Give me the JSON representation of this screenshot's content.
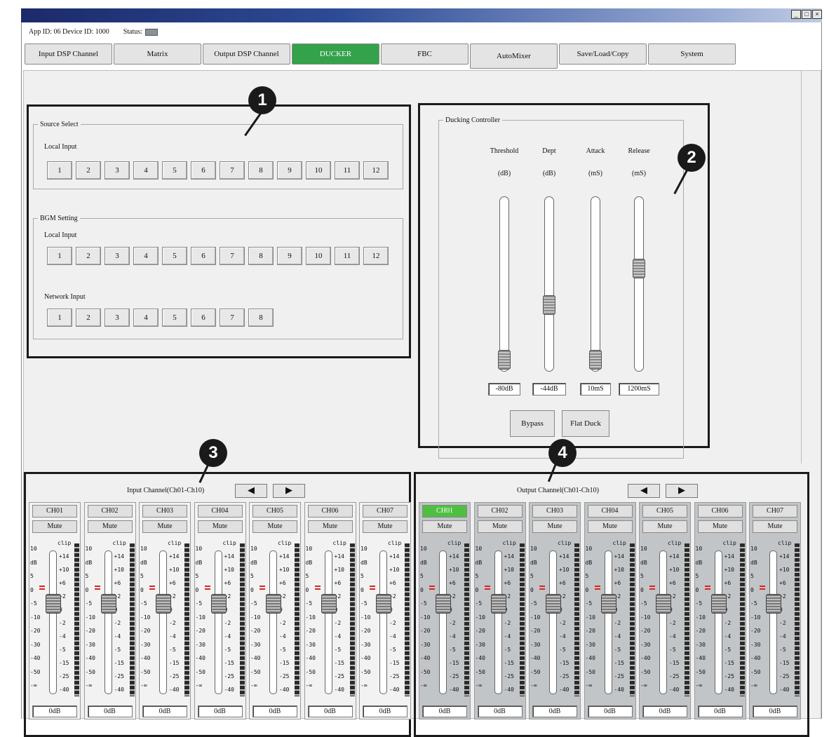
{
  "window": {
    "minimize": "_",
    "maximize": "□",
    "close": "×"
  },
  "info": {
    "app_device": "App ID: 06 Device ID: 1000",
    "status_label": "Status:"
  },
  "tabs": [
    {
      "label": "Input DSP Channel"
    },
    {
      "label": "Matrix"
    },
    {
      "label": "Output DSP Channel"
    },
    {
      "label": "DUCKER",
      "active": true
    },
    {
      "label": "FBC"
    },
    {
      "label": "AutoMixer"
    },
    {
      "label": "Save/Load/Copy"
    },
    {
      "label": "System"
    }
  ],
  "source_select": {
    "legend": "Source Select",
    "local_label": "Local Input",
    "local": [
      "1",
      "2",
      "3",
      "4",
      "5",
      "6",
      "7",
      "8",
      "9",
      "10",
      "11",
      "12"
    ]
  },
  "bgm": {
    "legend": "BGM Setting",
    "local_label": "Local Input",
    "local": [
      "1",
      "2",
      "3",
      "4",
      "5",
      "6",
      "7",
      "8",
      "9",
      "10",
      "11",
      "12"
    ],
    "network_label": "Network Input",
    "network": [
      "1",
      "2",
      "3",
      "4",
      "5",
      "6",
      "7",
      "8"
    ]
  },
  "ducking": {
    "legend": "Ducking Controller",
    "controls": [
      {
        "name": "Threshold",
        "unit": "(dB)",
        "value": "-80dB",
        "level": 0.0
      },
      {
        "name": "Dept",
        "unit": "(dB)",
        "value": "-44dB",
        "level": 0.36
      },
      {
        "name": "Attack",
        "unit": "(mS)",
        "value": "10mS",
        "level": 0.0
      },
      {
        "name": "Release",
        "unit": "(mS)",
        "value": "1200mS",
        "level": 0.6
      }
    ],
    "bypass": "Bypass",
    "flat_duck": "Flat Duck"
  },
  "callouts": [
    "1",
    "2",
    "3",
    "4"
  ],
  "input_channels": {
    "title": "Input Channel(Ch01-Ch10)",
    "prev": "◀",
    "next": "▶",
    "channels": [
      "CH01",
      "CH02",
      "CH03",
      "CH04",
      "CH05",
      "CH06",
      "CH07"
    ]
  },
  "output_channels": {
    "title": "Output Channel(Ch01-Ch10)",
    "prev": "◀",
    "next": "▶",
    "channels": [
      "CH01",
      "CH02",
      "CH03",
      "CH04",
      "CH05",
      "CH06",
      "CH07"
    ]
  },
  "strip": {
    "mute": "Mute",
    "value": "0dB",
    "scale_left": [
      "10",
      "dB",
      "5",
      "0",
      "-5",
      "-10",
      "-20",
      "-30",
      "-40",
      "-50",
      "-∞"
    ],
    "scale_right": [
      "clip",
      "+14",
      "+10",
      "+6",
      "+2",
      "0",
      "-2",
      "-4",
      "-5",
      "-15",
      "-25",
      "-40"
    ]
  }
}
